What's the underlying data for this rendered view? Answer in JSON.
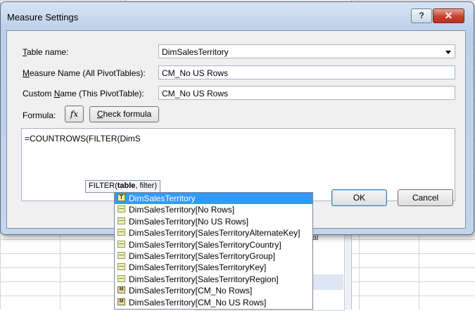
{
  "dialog": {
    "title": "Measure Settings",
    "help_label": "?",
    "close_label": "✕"
  },
  "form": {
    "table_name_label_u": "T",
    "table_name_label_rest": "able name:",
    "table_name_value": "DimSalesTerritory",
    "measure_name_label_u": "M",
    "measure_name_label_rest": "easure Name (All PivotTables):",
    "measure_name_value": "CM_No US Rows",
    "custom_name_label_pre": "Custom ",
    "custom_name_label_u": "N",
    "custom_name_label_rest": "ame (This PivotTable):",
    "custom_name_value": "CM_No US Rows",
    "formula_label": "Formula:",
    "fx_label": "fx",
    "check_formula_u": "C",
    "check_formula_rest": "heck formula",
    "formula_text": "=COUNTROWS(FILTER(DimS"
  },
  "tooltip": {
    "func": "FILTER(",
    "param_bold": "table",
    "rest": ", filter)"
  },
  "buttons": {
    "ok": "OK",
    "cancel": "Cancel"
  },
  "background": {
    "partial_text": "al"
  },
  "autocomplete": {
    "items": [
      {
        "label": "DimSalesTerritory",
        "icon": "table-icon",
        "glyph": "T"
      },
      {
        "label": "DimSalesTerritory[No Rows]",
        "icon": "column-icon",
        "glyph": ""
      },
      {
        "label": "DimSalesTerritory[No US Rows]",
        "icon": "column-icon",
        "glyph": ""
      },
      {
        "label": "DimSalesTerritory[SalesTerritoryAlternateKey]",
        "icon": "column-icon",
        "glyph": ""
      },
      {
        "label": "DimSalesTerritory[SalesTerritoryCountry]",
        "icon": "column-icon",
        "glyph": ""
      },
      {
        "label": "DimSalesTerritory[SalesTerritoryGroup]",
        "icon": "column-icon",
        "glyph": ""
      },
      {
        "label": "DimSalesTerritory[SalesTerritoryKey]",
        "icon": "column-icon",
        "glyph": ""
      },
      {
        "label": "DimSalesTerritory[SalesTerritoryRegion]",
        "icon": "column-icon",
        "glyph": ""
      },
      {
        "label": "DimSalesTerritory[CM_No Rows]",
        "icon": "measure-icon",
        "glyph": "M"
      },
      {
        "label": "DimSalesTerritory[CM_No US Rows]",
        "icon": "measure-icon",
        "glyph": "M"
      }
    ]
  }
}
